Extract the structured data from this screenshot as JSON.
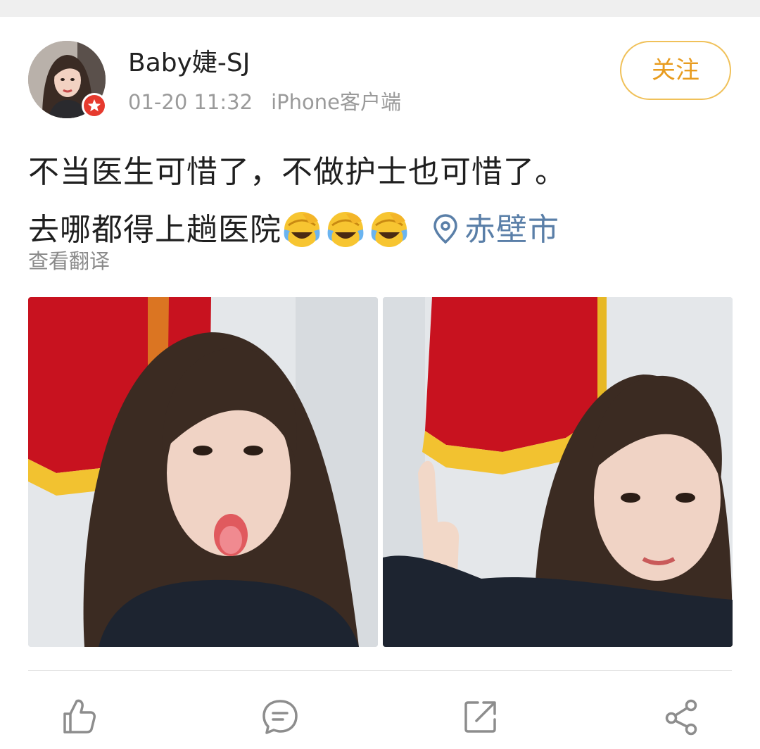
{
  "post": {
    "author": {
      "name": "Baby婕-SJ",
      "verified_badge_color": "#e63a2e"
    },
    "meta": {
      "time": "01-20 11:32",
      "source": "iPhone客户端"
    },
    "follow_label": "关注",
    "text": {
      "line1": "不当医生可惜了，不做护士也可惜了。",
      "line2": "去哪都得上趟医院",
      "emojis": [
        "laughing-crying-emoji",
        "laughing-crying-emoji",
        "laughing-crying-emoji"
      ],
      "location": "赤壁市"
    },
    "translate_label": "查看翻译",
    "images": [
      {
        "icon": "photo"
      },
      {
        "icon": "photo"
      }
    ],
    "actions": [
      {
        "icon": "thumbs-up-icon"
      },
      {
        "icon": "comment-icon"
      },
      {
        "icon": "forward-icon"
      },
      {
        "icon": "share-icon"
      }
    ]
  },
  "colors": {
    "accent": "#e89c1f",
    "follow_border": "#f0c15a",
    "location": "#5a7fa8",
    "muted": "#9a9a9a",
    "banner": "#c8121f"
  }
}
